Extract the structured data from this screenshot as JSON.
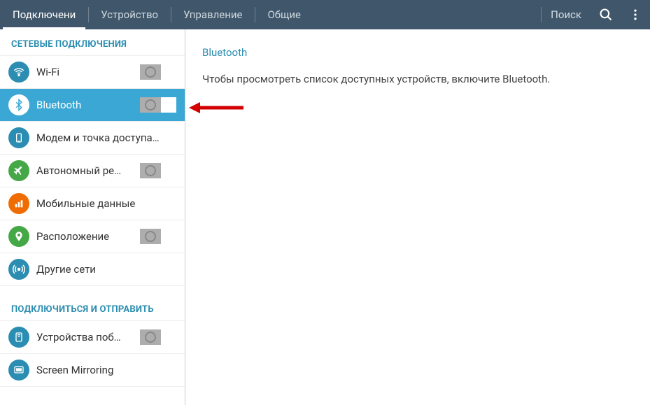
{
  "topbar": {
    "tabs": [
      "Подключени",
      "Устройство",
      "Управление",
      "Общие"
    ],
    "search_label": "Поиск"
  },
  "sidebar": {
    "section1_title": "СЕТЕВЫЕ ПОДКЛЮЧЕНИЯ",
    "section2_title": "ПОДКЛЮЧИТЬСЯ И ОТПРАВИТЬ",
    "items1": [
      {
        "label": "Wi-Fi"
      },
      {
        "label": "Bluetooth"
      },
      {
        "label": "Модем и точка доступа…"
      },
      {
        "label": "Автономный ре…"
      },
      {
        "label": "Мобильные данные"
      },
      {
        "label": "Расположение"
      },
      {
        "label": "Другие сети"
      }
    ],
    "items2": [
      {
        "label": "Устройства поб…"
      },
      {
        "label": "Screen Mirroring"
      }
    ]
  },
  "content": {
    "title": "Bluetooth",
    "body": "Чтобы просмотреть список доступных устройств, включите Bluetooth."
  }
}
